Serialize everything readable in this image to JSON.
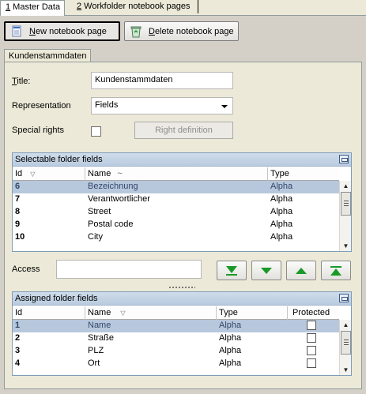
{
  "top_tabs": [
    {
      "key": "1",
      "label": " Master Data"
    },
    {
      "key": "2",
      "label": " Workfolder notebook pages"
    }
  ],
  "toolbar": {
    "new_label": "New notebook page",
    "new_mnemonic": "N",
    "delete_label": "Delete notebook page",
    "delete_mnemonic": "D"
  },
  "page_tab": "Kundenstammdaten",
  "form": {
    "title_label": "Title:",
    "title_mnemonic": "T",
    "title_value": "Kundenstammdaten",
    "representation_label": "Representation",
    "representation_value": "Fields",
    "special_rights_label": "Special rights",
    "right_definition_label": "Right definition",
    "access_label": "Access",
    "access_value": ""
  },
  "selectable": {
    "title": "Selectable folder fields",
    "headers": [
      "Id",
      "Name",
      "Type"
    ],
    "rows": [
      {
        "id": "6",
        "name": "Bezeichnung",
        "type": "Alpha",
        "selected": true
      },
      {
        "id": "7",
        "name": "Verantwortlicher",
        "type": "Alpha"
      },
      {
        "id": "8",
        "name": "Street",
        "type": "Alpha"
      },
      {
        "id": "9",
        "name": "Postal code",
        "type": "Alpha"
      },
      {
        "id": "10",
        "name": "City",
        "type": "Alpha"
      }
    ]
  },
  "assigned": {
    "title": "Assigned folder fields",
    "headers": [
      "Id",
      "Name",
      "Type",
      "Protected"
    ],
    "rows": [
      {
        "id": "1",
        "name": "Name",
        "type": "Alpha",
        "protected": false,
        "selected": true
      },
      {
        "id": "2",
        "name": "Straße",
        "type": "Alpha",
        "protected": false
      },
      {
        "id": "3",
        "name": "PLZ",
        "type": "Alpha",
        "protected": false
      },
      {
        "id": "4",
        "name": "Ort",
        "type": "Alpha",
        "protected": false
      }
    ]
  },
  "icons": {
    "new": "notebook-page-icon",
    "delete": "recycle-bin-icon",
    "move_bottom": "move-to-bottom-icon",
    "move_down": "move-down-icon",
    "move_up": "move-up-icon",
    "move_top": "move-to-top-icon"
  },
  "colors": {
    "selection": "#b8c8dc",
    "grid_title": "#b9cbe0",
    "arrow_green": "#199a28"
  }
}
